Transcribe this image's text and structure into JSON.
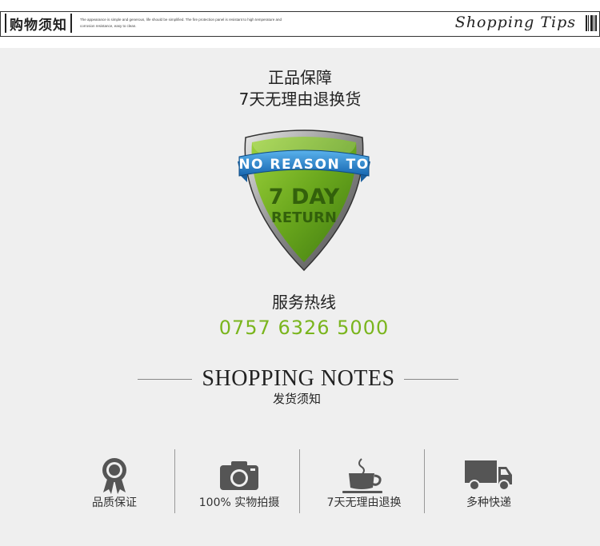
{
  "header": {
    "title": "购物须知",
    "description": "The appearance is simple and generous, life should be simplified. The fire protection panel is resistant to high temperature and corrosion resistance, easy to clean.",
    "tips": "Shopping Tips"
  },
  "guarantee": {
    "line1": "正品保障",
    "line2": "7天无理由退换货"
  },
  "badge": {
    "banner": "NO REASON TO",
    "days": "7 DAY",
    "word": "RETURN"
  },
  "service": {
    "label": "服务热线",
    "phone": "0757 6326 5000"
  },
  "notes": {
    "title": "SHOPPING NOTES",
    "subtitle": "发货须知"
  },
  "features": [
    {
      "icon": "award-ribbon-icon",
      "label": "品质保证"
    },
    {
      "icon": "camera-icon",
      "label": "100% 实物拍摄"
    },
    {
      "icon": "coffee-cup-icon",
      "label": "7天无理由退换"
    },
    {
      "icon": "delivery-truck-icon",
      "label": "多种快递"
    }
  ],
  "colors": {
    "accent_green": "#7ab51d",
    "panel_bg": "#efefef",
    "icon_gray": "#555555"
  }
}
